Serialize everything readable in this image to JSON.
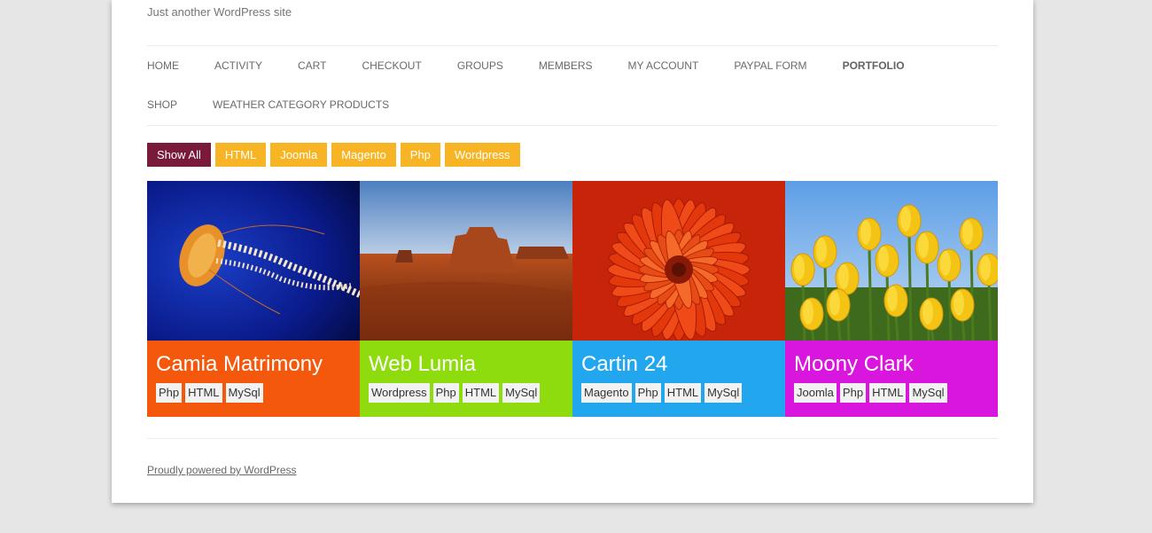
{
  "site": {
    "tagline": "Just another WordPress site"
  },
  "nav": {
    "items": [
      {
        "label": "HOME"
      },
      {
        "label": "ACTIVITY"
      },
      {
        "label": "CART"
      },
      {
        "label": "CHECKOUT"
      },
      {
        "label": "GROUPS"
      },
      {
        "label": "MEMBERS"
      },
      {
        "label": "MY ACCOUNT"
      },
      {
        "label": "PAYPAL FORM"
      },
      {
        "label": "PORTFOLIO",
        "active": true
      },
      {
        "label": "SHOP"
      },
      {
        "label": "WEATHER CATEGORY PRODUCTS"
      }
    ]
  },
  "filters": [
    {
      "label": "Show All",
      "active": true
    },
    {
      "label": "HTML"
    },
    {
      "label": "Joomla"
    },
    {
      "label": "Magento"
    },
    {
      "label": "Php"
    },
    {
      "label": "Wordpress"
    }
  ],
  "portfolio": [
    {
      "title": "Camia Matrimony",
      "color": "#f4580d",
      "image": "jellyfish",
      "tags": [
        "Php",
        "HTML",
        "MySql"
      ]
    },
    {
      "title": "Web Lumia",
      "color": "#8fdc0e",
      "image": "desert",
      "tags": [
        "Wordpress",
        "Php",
        "HTML",
        "MySql"
      ]
    },
    {
      "title": "Cartin 24",
      "color": "#22a7ee",
      "image": "chrysanthemum",
      "tags": [
        "Magento",
        "Php",
        "HTML",
        "MySql"
      ]
    },
    {
      "title": "Moony Clark",
      "color": "#d916dd",
      "image": "tulips",
      "tags": [
        "Joomla",
        "Php",
        "HTML",
        "MySql"
      ]
    }
  ],
  "footer": {
    "credit": "Proudly powered by WordPress"
  }
}
